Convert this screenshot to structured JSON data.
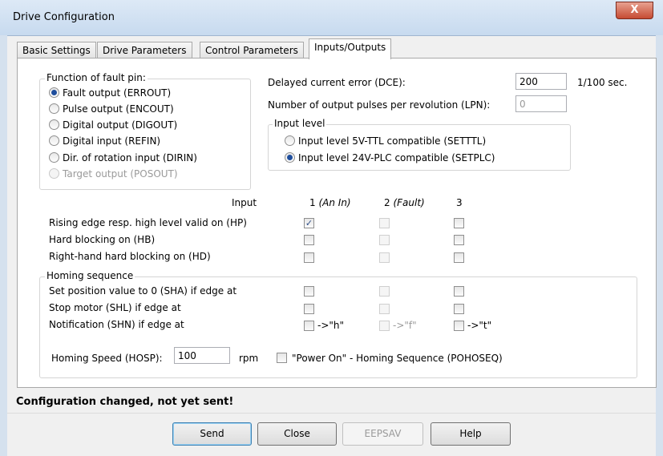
{
  "window": {
    "title": "Drive Configuration",
    "close_glyph": "X"
  },
  "tabs": [
    "Basic Settings",
    "Drive Parameters",
    "Control Parameters",
    "Inputs/Outputs"
  ],
  "active_tab": "Inputs/Outputs",
  "fault_pin": {
    "label": "Function of fault pin:",
    "options": [
      {
        "label": "Fault output (ERROUT)",
        "checked": true,
        "enabled": true
      },
      {
        "label": "Pulse output (ENCOUT)",
        "checked": false,
        "enabled": true
      },
      {
        "label": "Digital output (DIGOUT)",
        "checked": false,
        "enabled": true
      },
      {
        "label": "Digital input (REFIN)",
        "checked": false,
        "enabled": true
      },
      {
        "label": "Dir. of rotation input (DIRIN)",
        "checked": false,
        "enabled": true
      },
      {
        "label": "Target output (POSOUT)",
        "checked": false,
        "enabled": false
      }
    ]
  },
  "dce": {
    "label": "Delayed current error (DCE):",
    "value": "200",
    "unit": "1/100 sec."
  },
  "lpn": {
    "label": "Number of output pulses per revolution (LPN):",
    "value": "0"
  },
  "input_level": {
    "label": "Input level",
    "options": [
      {
        "label": "Input level 5V-TTL compatible (SETTTL)",
        "checked": false
      },
      {
        "label": "Input level 24V-PLC compatible (SETPLC)",
        "checked": true
      }
    ]
  },
  "inputs": {
    "header_label": "Input",
    "columns": [
      {
        "number": "1",
        "note": "(An In)"
      },
      {
        "number": "2",
        "note": "(Fault)"
      },
      {
        "number": "3",
        "note": ""
      }
    ],
    "rows": [
      {
        "label": "Rising edge resp. high level valid on (HP)",
        "checks": [
          true,
          false,
          false
        ]
      },
      {
        "label": "Hard blocking on (HB)",
        "checks": [
          false,
          false,
          false
        ]
      },
      {
        "label": "Right-hand hard blocking on (HD)",
        "checks": [
          false,
          false,
          false
        ]
      }
    ]
  },
  "homing": {
    "label": "Homing sequence",
    "rows": [
      {
        "label": "Set position value to 0 (SHA) if edge at"
      },
      {
        "label": "Stop motor (SHL) if edge at"
      },
      {
        "label": "Notification (SHN) if edge at",
        "arrows": [
          "->\"h\"",
          "->\"f\"",
          "->\"t\""
        ]
      }
    ],
    "speed_label": "Homing Speed (HOSP):",
    "speed_value": "100",
    "speed_unit": "rpm",
    "power_on_label": "\"Power On\" - Homing Sequence (POHOSEQ)"
  },
  "status": "Configuration changed, not yet sent!",
  "buttons": {
    "send": "Send",
    "close": "Close",
    "eepsav": "EEPSAV",
    "help": "Help"
  }
}
